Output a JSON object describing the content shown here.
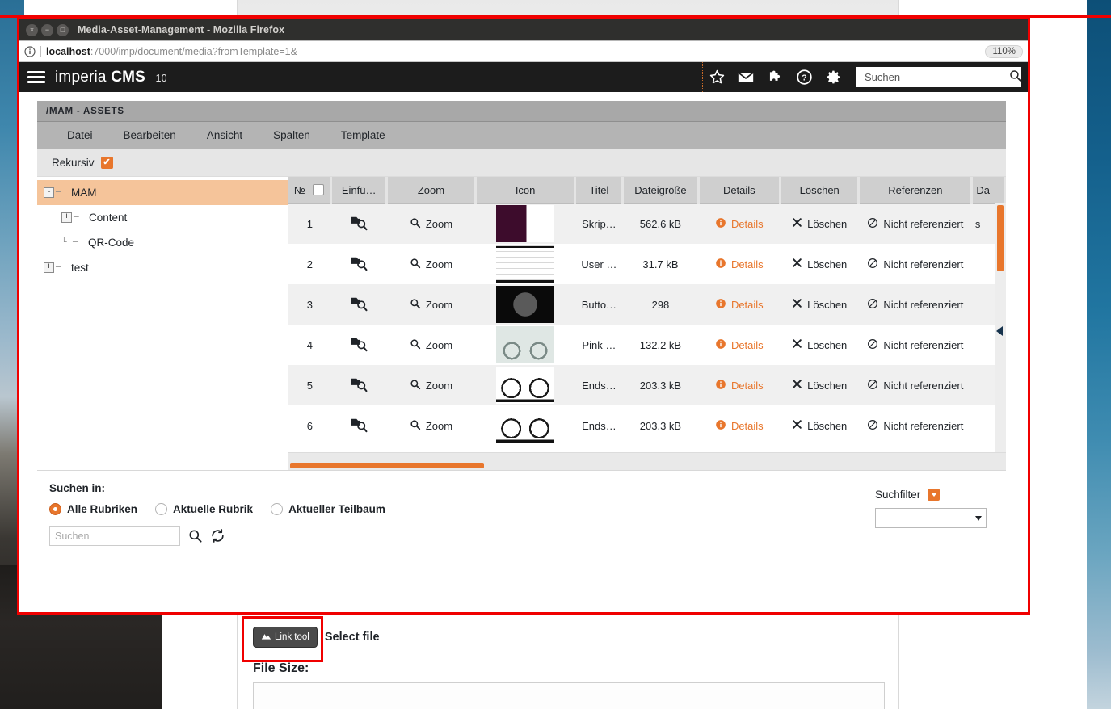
{
  "browser": {
    "window_title": "Media-Asset-Management - Mozilla Firefox",
    "url_host": "localhost",
    "url_rest": ":7000/imp/document/media?fromTemplate=1&",
    "zoom_level": "110%",
    "close_glyph": "×",
    "minimize_glyph": "−",
    "maximize_glyph": "□"
  },
  "cms_header": {
    "brand_light": "imperia",
    "brand_bold": "CMS",
    "version": "10",
    "search_placeholder": "Suchen",
    "icons": [
      "star-icon",
      "envelope-icon",
      "puzzle-icon",
      "help-icon",
      "gear-icon"
    ]
  },
  "breadcrumb": "/MAM - ASSETS",
  "menu": {
    "items": [
      "Datei",
      "Bearbeiten",
      "Ansicht",
      "Spalten",
      "Template"
    ]
  },
  "options": {
    "recursive_label": "Rekursiv",
    "recursive_checked": true,
    "check_glyph": "✔"
  },
  "tree": {
    "nodes": [
      {
        "label": "MAM",
        "indent": 0,
        "toggle": "-",
        "selected": true
      },
      {
        "label": "Content",
        "indent": 1,
        "toggle": "+",
        "selected": false
      },
      {
        "label": "QR-Code",
        "indent": 1,
        "toggle": "",
        "selected": false
      },
      {
        "label": "test",
        "indent": 0,
        "toggle": "+",
        "selected": false
      }
    ]
  },
  "table": {
    "columns": [
      "№",
      "Einfü…",
      "Zoom",
      "Icon",
      "Titel",
      "Dateigröße",
      "Details",
      "Löschen",
      "Referenzen",
      "Da"
    ],
    "zoom_label": "Zoom",
    "details_label": "Details",
    "delete_label": "Löschen",
    "rows": [
      {
        "no": "1",
        "title": "Skrip…",
        "size": "562.6 kB",
        "details": "Details",
        "delete": "Löschen",
        "reference": "Nicht referenziert",
        "extra": "s",
        "thumb": "code-screenshot"
      },
      {
        "no": "2",
        "title": "User …",
        "size": "31.7 kB",
        "details": "Details",
        "delete": "Löschen",
        "reference": "Nicht referenziert",
        "extra": "",
        "thumb": "document-page"
      },
      {
        "no": "3",
        "title": "Butto…",
        "size": "298",
        "details": "Details",
        "delete": "Löschen",
        "reference": "Nicht referenziert",
        "extra": "",
        "thumb": "button-dark"
      },
      {
        "no": "4",
        "title": "Pink …",
        "size": "132.2 kB",
        "details": "Details",
        "delete": "Löschen",
        "reference": "Nicht referenziert",
        "extra": "",
        "thumb": "bicycle-light"
      },
      {
        "no": "5",
        "title": "Ends…",
        "size": "203.3 kB",
        "details": "Details",
        "delete": "Löschen",
        "reference": "Nicht referenziert",
        "extra": "",
        "thumb": "bicycle-black"
      },
      {
        "no": "6",
        "title": "Ends…",
        "size": "203.3 kB",
        "details": "Details",
        "delete": "Löschen",
        "reference": "Nicht referenziert",
        "extra": "",
        "thumb": "bicycle-black"
      }
    ]
  },
  "search_footer": {
    "heading": "Suchen in:",
    "radios": [
      {
        "label": "Alle Rubriken",
        "selected": true
      },
      {
        "label": "Aktuelle Rubrik",
        "selected": false
      },
      {
        "label": "Aktueller Teilbaum",
        "selected": false
      }
    ],
    "search_placeholder": "Suchen",
    "search_value": "",
    "filter_label": "Suchfilter",
    "filter_value": ""
  },
  "under_form": {
    "link_tool_label": "Link tool",
    "select_file_label": "Select file",
    "file_size_label": "File Size:",
    "file_size_value": ""
  },
  "colors": {
    "accent_orange": "#e8762c",
    "tree_selection": "#f5c49a",
    "annotation_red": "#f00000",
    "header_dark": "#1c1c1c"
  }
}
